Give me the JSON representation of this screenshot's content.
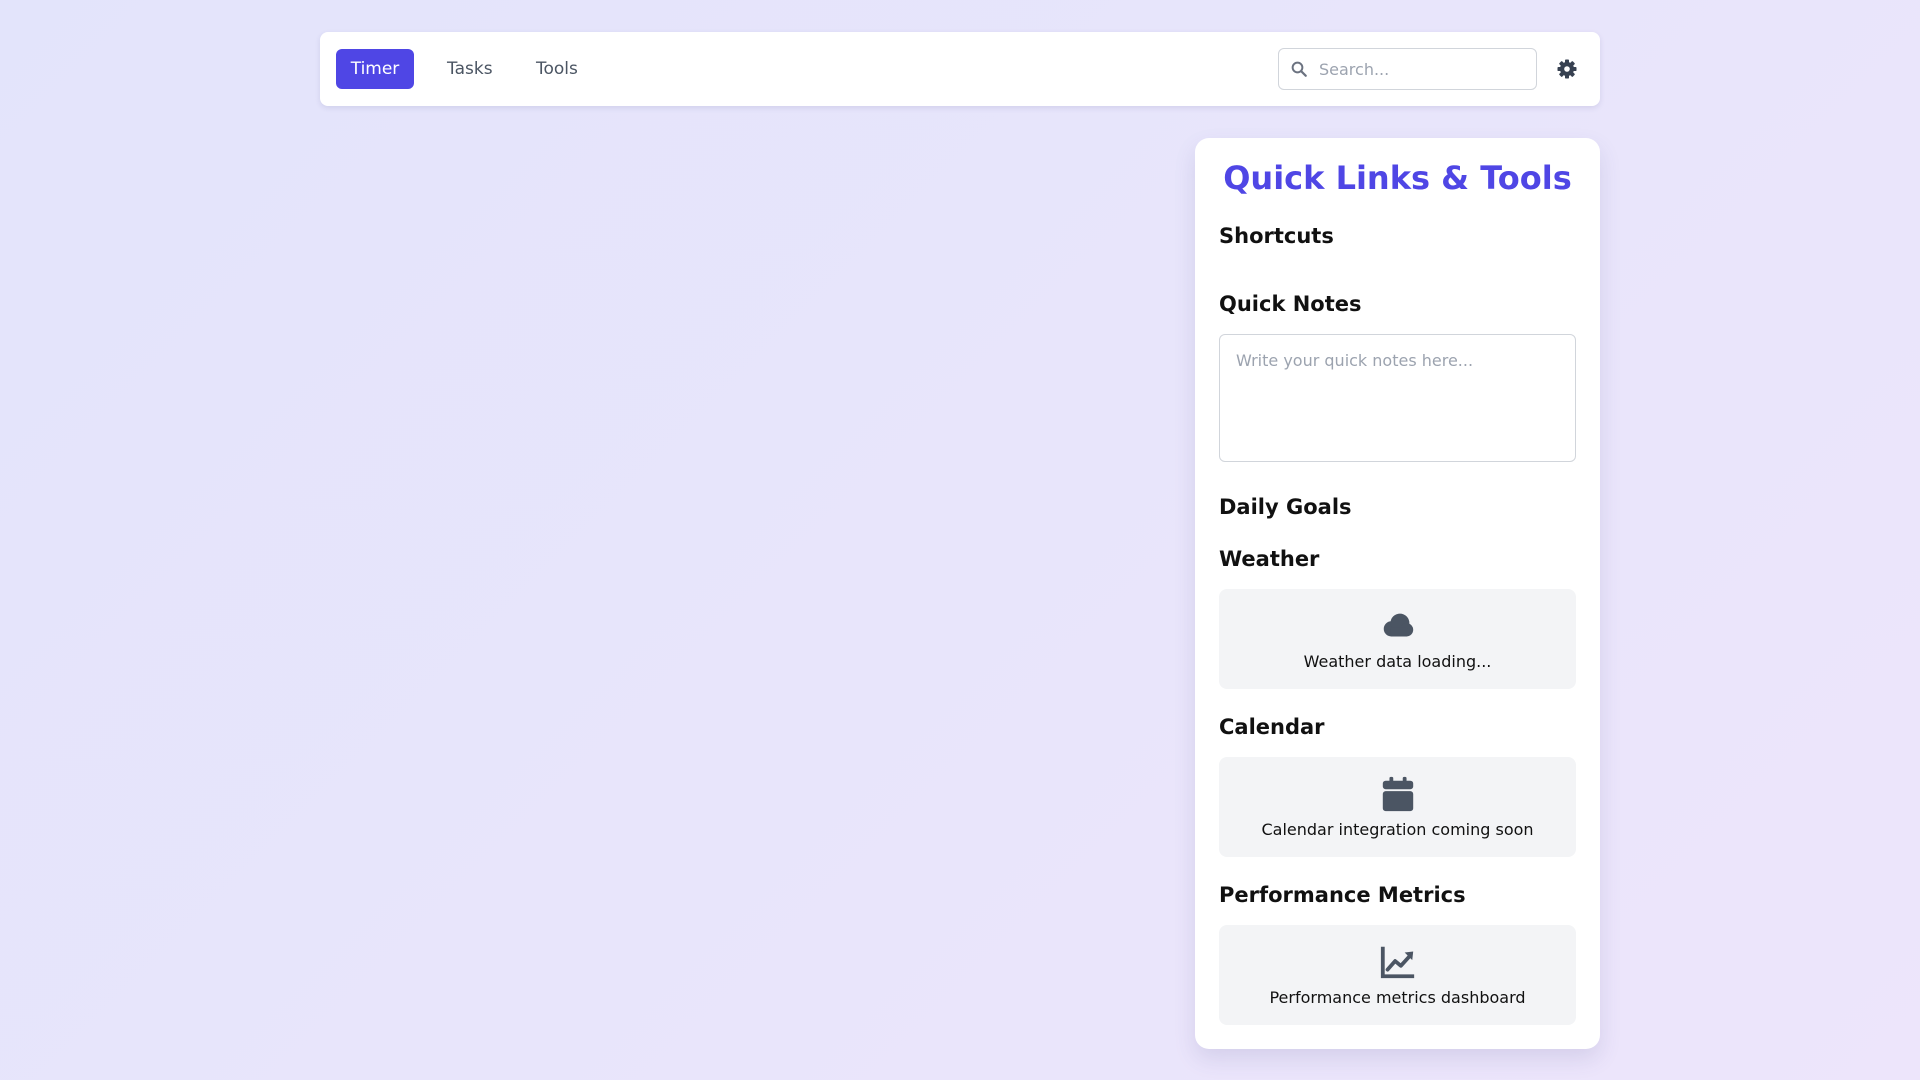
{
  "nav": {
    "tabs": [
      {
        "label": "Timer",
        "active": true
      },
      {
        "label": "Tasks",
        "active": false
      },
      {
        "label": "Tools",
        "active": false
      }
    ],
    "search": {
      "placeholder": "Search...",
      "value": "",
      "icon": "search-icon"
    },
    "settings_icon": "gear-icon"
  },
  "panel": {
    "title": "Quick Links & Tools",
    "sections": {
      "shortcuts": {
        "heading": "Shortcuts"
      },
      "quick_notes": {
        "heading": "Quick Notes",
        "placeholder": "Write your quick notes here...",
        "value": ""
      },
      "daily_goals": {
        "heading": "Daily Goals"
      },
      "weather": {
        "heading": "Weather",
        "icon": "cloud-icon",
        "text": "Weather data loading..."
      },
      "calendar": {
        "heading": "Calendar",
        "icon": "calendar-icon",
        "text": "Calendar integration coming soon"
      },
      "performance": {
        "heading": "Performance Metrics",
        "icon": "chart-line-icon",
        "text": "Performance metrics dashboard"
      }
    }
  },
  "colors": {
    "accent": "#4f46e5",
    "card_bg": "#f3f4f6",
    "icon": "#4b5563",
    "background": "#e6e5fb"
  }
}
